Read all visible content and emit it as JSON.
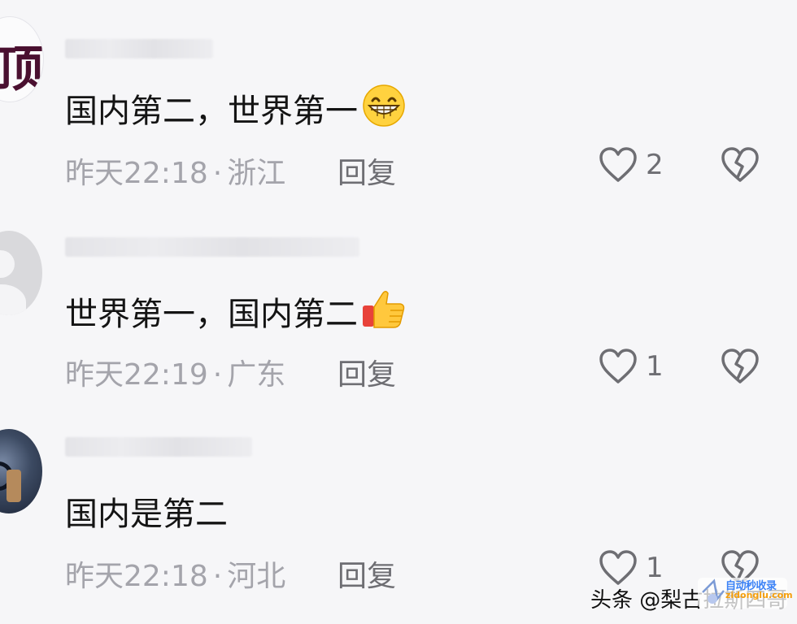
{
  "comments": [
    {
      "text": "国内第二，世界第一",
      "emoji": "grinning-face-emoji",
      "time": "昨天22:18",
      "location": "浙江",
      "reply_label": "回复",
      "likes": "2"
    },
    {
      "text": "世界第一，国内第二",
      "emoji": "thumbs-up-emoji",
      "time": "昨天22:19",
      "location": "广东",
      "reply_label": "回复",
      "likes": "1"
    },
    {
      "text": "国内是第二",
      "emoji": "",
      "time": "昨天22:18",
      "location": "河北",
      "reply_label": "回复",
      "likes": "1"
    }
  ],
  "meta_separator": "·",
  "watermark": {
    "text": "头条 @梨古拉斯四哥",
    "logo_text": "自动秒收录",
    "logo_sub": "zidonglu.com"
  },
  "colors": {
    "background": "#f6f6f8",
    "text": "#141414",
    "meta": "#a4a4ab",
    "icon": "#6e6e73"
  }
}
